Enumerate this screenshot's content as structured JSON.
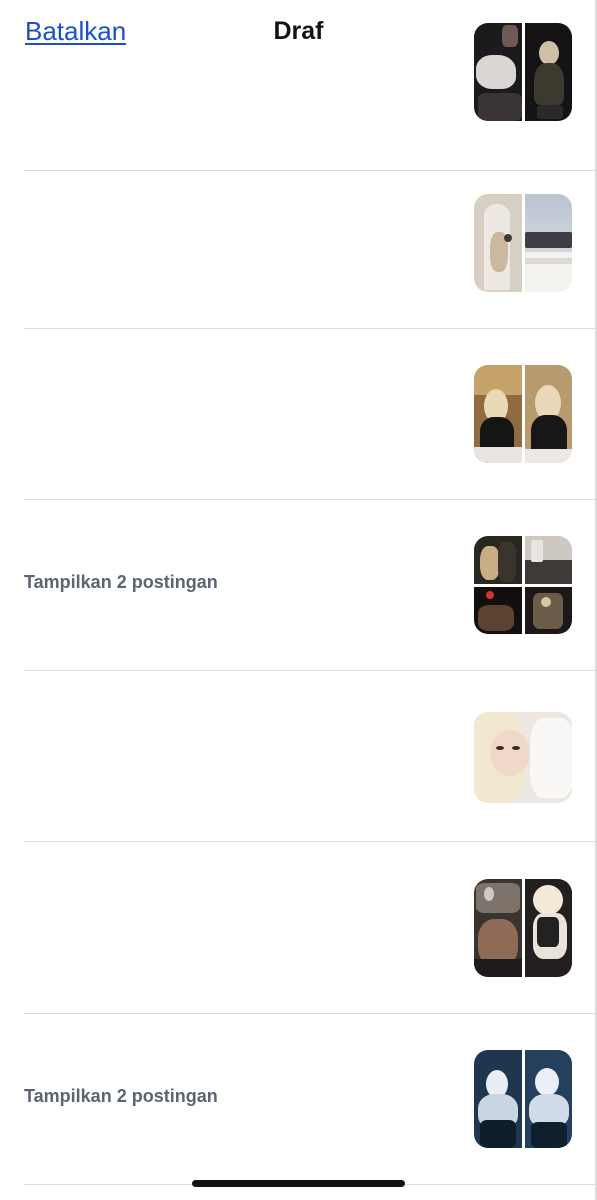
{
  "header": {
    "cancel_label": "Batalkan",
    "title": "Draf"
  },
  "drafts": [
    {
      "label": "",
      "thumbnail": "two-photo-collage"
    },
    {
      "label": "",
      "thumbnail": "two-photo-collage"
    },
    {
      "label": "",
      "thumbnail": "two-photo-collage"
    },
    {
      "label": "Tampilkan 2 postingan",
      "thumbnail": "four-photo-collage"
    },
    {
      "label": "",
      "thumbnail": "single-photo"
    },
    {
      "label": "",
      "thumbnail": "two-photo-collage"
    },
    {
      "label": "Tampilkan 2 postingan",
      "thumbnail": "two-photo-collage"
    }
  ],
  "colors": {
    "link": "#1a4fcf",
    "title": "#0f1419",
    "secondary_text": "#5b6570",
    "divider": "#d9dcdf"
  }
}
